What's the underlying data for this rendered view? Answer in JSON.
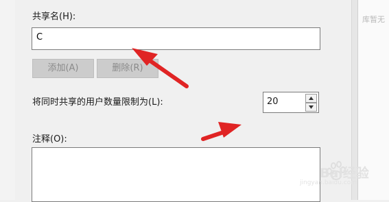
{
  "share_name": {
    "label": "共享名(H):",
    "value": "C"
  },
  "buttons": {
    "add_label": "添加(A)",
    "remove_label": "删除(R)"
  },
  "user_limit": {
    "label": "将同时共享的用户数量限制为(L):",
    "value": "20"
  },
  "comment": {
    "label": "注释(O):",
    "value": ""
  },
  "background_text": "库暂无",
  "watermark": {
    "text": "Bai经验",
    "sub": "jingyan.baidu.com"
  },
  "annotation_color": "#e02424"
}
